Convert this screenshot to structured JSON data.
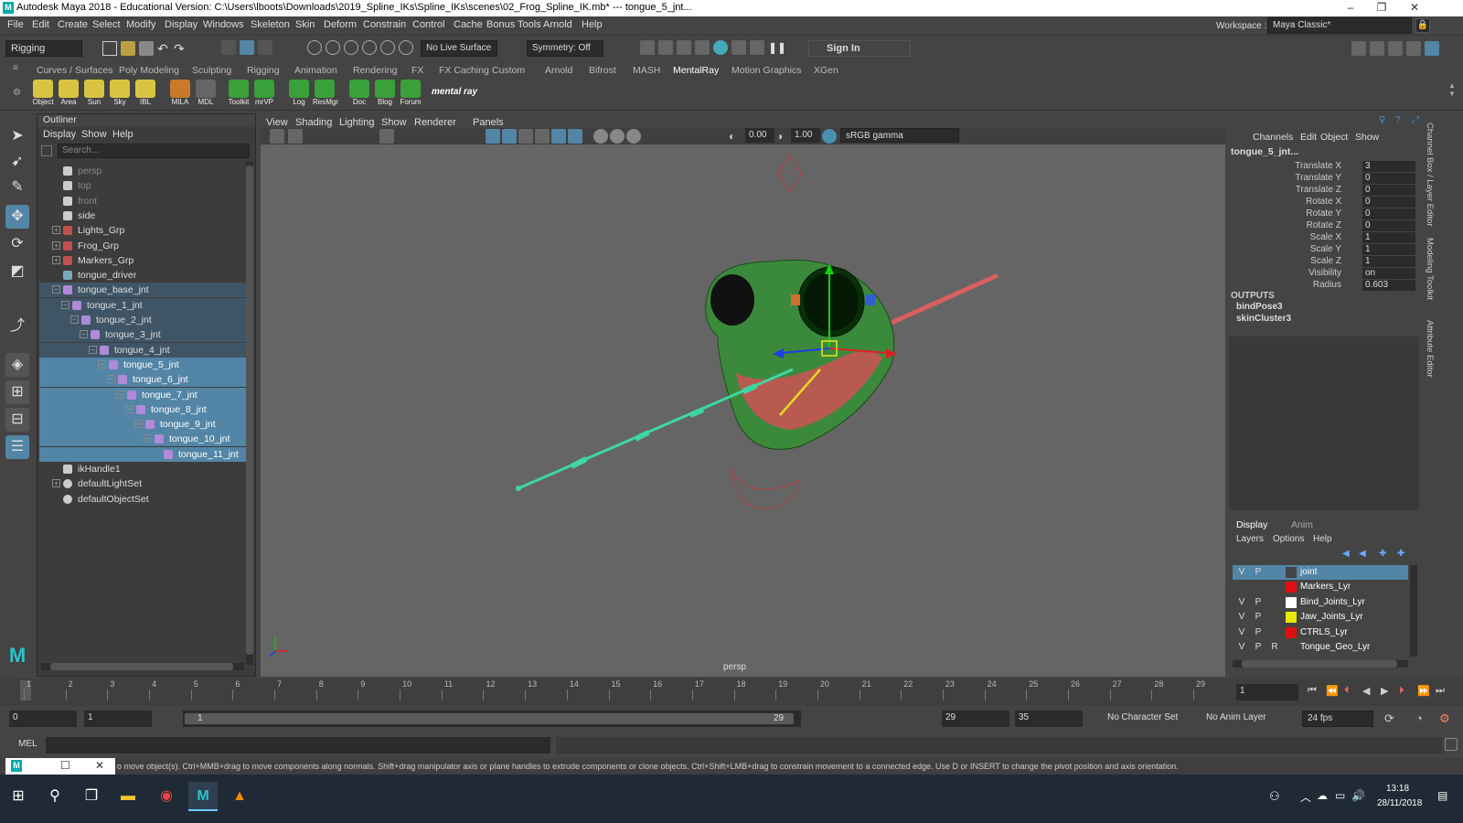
{
  "app": {
    "title": "Autodesk Maya 2018 - Educational Version: C:\\Users\\lboots\\Downloads\\2019_Spline_IKs\\Spline_IKs\\scenes\\02_Frog_Spline_IK.mb*  ---  tongue_5_jnt...",
    "logo_letter": "M"
  },
  "window_controls": {
    "minimize": "–",
    "restore": "❐",
    "close": "✕"
  },
  "menu": [
    "File",
    "Edit",
    "Create",
    "Select",
    "Modify",
    "Display",
    "Windows",
    "Skeleton",
    "Skin",
    "Deform",
    "Constrain",
    "Control",
    "Cache",
    "Bonus Tools",
    "Arnold",
    "Help"
  ],
  "workspace": {
    "label": "Workspace :",
    "value": "Maya Classic*"
  },
  "statusline": {
    "menuset": "Rigging",
    "live_surface": "No Live Surface",
    "symmetry": "Symmetry: Off",
    "sign_in": "Sign In"
  },
  "shelf_tabs": [
    "Curves / Surfaces",
    "Poly Modeling",
    "Sculpting",
    "Rigging",
    "Animation",
    "Rendering",
    "FX",
    "FX Caching",
    "Custom",
    "Arnold",
    "Bifrost",
    "MASH",
    "MentalRay",
    "Motion Graphics",
    "XGen"
  ],
  "shelf_active": "MentalRay",
  "shelf_buttons": [
    {
      "label": "Object",
      "color": "#d8c440"
    },
    {
      "label": "Area",
      "color": "#d8c440"
    },
    {
      "label": "Sun",
      "color": "#d8c440"
    },
    {
      "label": "Sky",
      "color": "#d8c440"
    },
    {
      "label": "IBL",
      "color": "#d8c440"
    },
    {
      "label": "MILA",
      "color": "#c87a2a"
    },
    {
      "label": "MDL",
      "color": "#666666"
    },
    {
      "label": "Toolkit",
      "color": "#3aa03a"
    },
    {
      "label": "mrVP",
      "color": "#3aa03a"
    },
    {
      "label": "Log",
      "color": "#3aa03a"
    },
    {
      "label": "ResMgr",
      "color": "#3aa03a"
    },
    {
      "label": "Doc",
      "color": "#3aa03a"
    },
    {
      "label": "Blog",
      "color": "#3aa03a"
    },
    {
      "label": "Forum",
      "color": "#3aa03a"
    }
  ],
  "shelf_logo": "mental ray",
  "outliner": {
    "title": "Outliner",
    "menu": [
      "Display",
      "Show",
      "Help"
    ],
    "search_placeholder": "Search...",
    "rows": [
      {
        "label": "persp",
        "indent": 0,
        "icon": "camera",
        "dim": true
      },
      {
        "label": "top",
        "indent": 0,
        "icon": "camera",
        "dim": true
      },
      {
        "label": "front",
        "indent": 0,
        "icon": "camera",
        "dim": true
      },
      {
        "label": "side",
        "indent": 0,
        "icon": "camera",
        "dim": false
      },
      {
        "label": "Lights_Grp",
        "indent": 0,
        "icon": "group",
        "expand": "+"
      },
      {
        "label": "Frog_Grp",
        "indent": 0,
        "icon": "group",
        "expand": "+"
      },
      {
        "label": "Markers_Grp",
        "indent": 0,
        "icon": "group",
        "expand": "+"
      },
      {
        "label": "tongue_driver",
        "indent": 0,
        "icon": "curve"
      },
      {
        "label": "tongue_base_jnt",
        "indent": 0,
        "icon": "joint",
        "expand": "−",
        "sel": 1
      },
      {
        "label": "tongue_1_jnt",
        "indent": 1,
        "icon": "joint",
        "expand": "−",
        "sel": 1
      },
      {
        "label": "tongue_2_jnt",
        "indent": 2,
        "icon": "joint",
        "expand": "−",
        "sel": 1
      },
      {
        "label": "tongue_3_jnt",
        "indent": 3,
        "icon": "joint",
        "expand": "−",
        "sel": 1
      },
      {
        "label": "tongue_4_jnt",
        "indent": 4,
        "icon": "joint",
        "expand": "−",
        "sel": 1
      },
      {
        "label": "tongue_5_jnt",
        "indent": 5,
        "icon": "joint",
        "expand": "−",
        "sel": 2
      },
      {
        "label": "tongue_6_jnt",
        "indent": 6,
        "icon": "joint",
        "expand": "−",
        "sel": 2
      },
      {
        "label": "tongue_7_jnt",
        "indent": 7,
        "icon": "joint",
        "expand": "−",
        "sel": 2
      },
      {
        "label": "tongue_8_jnt",
        "indent": 8,
        "icon": "joint",
        "expand": "−",
        "sel": 2
      },
      {
        "label": "tongue_9_jnt",
        "indent": 9,
        "icon": "joint",
        "expand": "−",
        "sel": 2
      },
      {
        "label": "tongue_10_jnt",
        "indent": 10,
        "icon": "joint",
        "expand": "−",
        "sel": 2
      },
      {
        "label": "tongue_11_jnt",
        "indent": 11,
        "icon": "joint",
        "sel": 2
      },
      {
        "label": "ikHandle1",
        "indent": 0,
        "icon": "ik"
      },
      {
        "label": "defaultLightSet",
        "indent": 0,
        "icon": "set",
        "expand": "+"
      },
      {
        "label": "defaultObjectSet",
        "indent": 0,
        "icon": "set"
      }
    ]
  },
  "viewport": {
    "menu": [
      "View",
      "Shading",
      "Lighting",
      "Show",
      "Renderer",
      "Panels"
    ],
    "near_value": "0.00",
    "gamma_value": "1.00",
    "color_space": "sRGB gamma",
    "camera_label": "persp"
  },
  "channel_box": {
    "menu": [
      "Channels",
      "Edit",
      "Object",
      "Show"
    ],
    "node": "tongue_5_jnt...",
    "attributes": [
      {
        "name": "Translate X",
        "value": "3"
      },
      {
        "name": "Translate Y",
        "value": "0"
      },
      {
        "name": "Translate Z",
        "value": "0"
      },
      {
        "name": "Rotate X",
        "value": "0"
      },
      {
        "name": "Rotate Y",
        "value": "0"
      },
      {
        "name": "Rotate Z",
        "value": "0"
      },
      {
        "name": "Scale X",
        "value": "1"
      },
      {
        "name": "Scale Y",
        "value": "1"
      },
      {
        "name": "Scale Z",
        "value": "1"
      },
      {
        "name": "Visibility",
        "value": "on"
      },
      {
        "name": "Radius",
        "value": "0.603"
      }
    ],
    "outputs_label": "OUTPUTS",
    "outputs": [
      "bindPose3",
      "skinCluster3"
    ]
  },
  "side_tabs": [
    "Channel Box / Layer Editor",
    "Modeling Toolkit",
    "Attribute Editor"
  ],
  "layer_editor": {
    "tabs": [
      "Display",
      "Anim"
    ],
    "menu": [
      "Layers",
      "Options",
      "Help"
    ],
    "layers": [
      {
        "v": "V",
        "p": "P",
        "r": "",
        "name": "joint",
        "color": "#444444",
        "selected": true
      },
      {
        "v": "",
        "p": "",
        "r": "",
        "name": "Markers_Lyr",
        "color": "#e01010"
      },
      {
        "v": "V",
        "p": "P",
        "r": "",
        "name": "Bind_Joints_Lyr",
        "color": "#ffffff"
      },
      {
        "v": "V",
        "p": "P",
        "r": "",
        "name": "Jaw_Joints_Lyr",
        "color": "#e8e800"
      },
      {
        "v": "V",
        "p": "P",
        "r": "",
        "name": "CTRLS_Lyr",
        "color": "#e01010"
      },
      {
        "v": "V",
        "p": "P",
        "r": "R",
        "name": "Tongue_Geo_Lyr",
        "color": "#444444"
      }
    ]
  },
  "timeline": {
    "ticks": [
      "1",
      "2",
      "3",
      "4",
      "5",
      "6",
      "7",
      "8",
      "9",
      "10",
      "11",
      "12",
      "13",
      "14",
      "15",
      "16",
      "17",
      "18",
      "19",
      "20",
      "21",
      "22",
      "23",
      "24",
      "25",
      "26",
      "27",
      "28",
      "29"
    ],
    "current_frame": "1"
  },
  "range": {
    "anim_start": "0",
    "playback_start": "1",
    "slider_start": "1",
    "slider_end": "29",
    "playback_end": "29",
    "anim_end": "35",
    "character_set": "No Character Set",
    "anim_layer": "No Anim Layer",
    "fps": "24 fps"
  },
  "mel": {
    "label": "MEL"
  },
  "help_line": "o move object(s). Ctrl+MMB+drag to move components along normals. Shift+drag manipulator axis or plane handles to extrude components or clone objects. Ctrl+Shift+LMB+drag to constrain movement to a connected edge. Use D or INSERT to change the pivot position and axis orientation.",
  "taskbar": {
    "time": "13:18",
    "date": "28/11/2018"
  }
}
